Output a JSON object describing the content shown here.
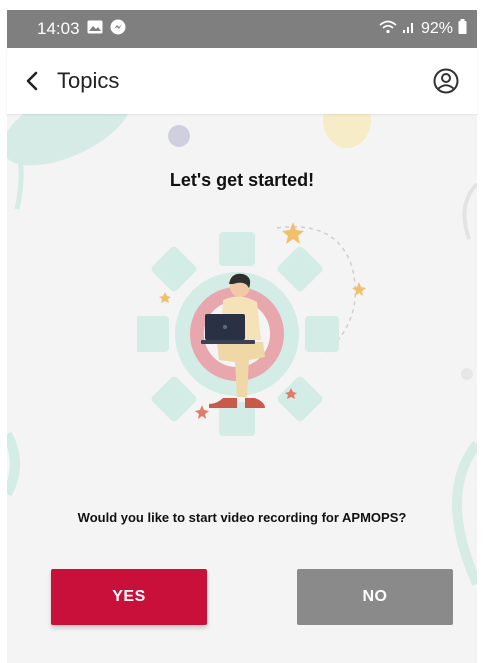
{
  "status_bar": {
    "time": "14:03",
    "left_icons": [
      "gallery-icon",
      "messenger-icon"
    ],
    "right_icons": [
      "wifi-icon",
      "signal-icon",
      "battery-icon"
    ],
    "battery": "92%"
  },
  "app_bar": {
    "back_icon": "chevron-left-icon",
    "title": "Topics",
    "profile_icon": "account-circle-icon"
  },
  "content": {
    "heading": "Let's get started!",
    "question": "Would you like to start video recording for APMOPS?",
    "yes_label": "YES",
    "no_label": "NO"
  },
  "colors": {
    "status_bar": "#7f7f7f",
    "content_bg": "#f4f4f4",
    "primary": "#c8103b",
    "secondary": "#8a8a8a",
    "gear": "#d3ece6",
    "accent_pink": "#e8a6ad",
    "star": "#f0c06a"
  }
}
